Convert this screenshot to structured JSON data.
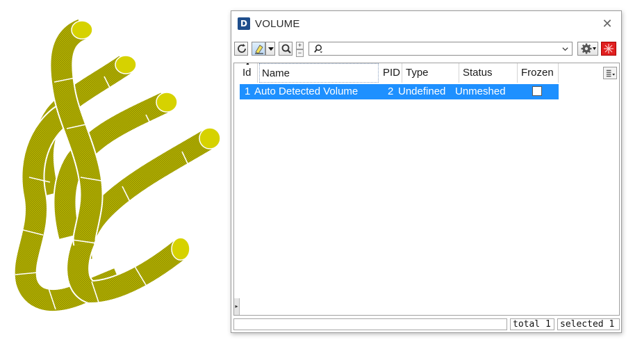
{
  "window": {
    "title": "VOLUME",
    "logo_letter": "D",
    "close_glyph": "✕"
  },
  "toolbar": {
    "icons": [
      "refresh-icon",
      "highlight-icon",
      "dropdown-arrow-icon",
      "zoom-icon",
      "plus-icon",
      "minus-icon",
      "search-icon",
      "combo-arrow-icon",
      "settings-icon",
      "reset-icon"
    ],
    "zoom_plus": "+",
    "zoom_minus": "−",
    "search": {
      "value": "",
      "placeholder": ""
    }
  },
  "table": {
    "sort_indicator": "▲",
    "columns": [
      "Id",
      "Name",
      "PID",
      "Type",
      "Status",
      "Frozen"
    ],
    "rows": [
      {
        "id": "1",
        "name": "Auto Detected Volume",
        "pid": "2",
        "type": "Undefined",
        "status": "Unmeshed",
        "frozen": false,
        "selected": true
      }
    ]
  },
  "statusbar": {
    "total": "total 1",
    "selected": "selected 1"
  },
  "colors": {
    "selection": "#1e90ff",
    "pipe": "#b8b400",
    "pipe_shadow": "#6f6c00",
    "settings_accent": "#e02020",
    "logo": "#1f4e8c"
  }
}
